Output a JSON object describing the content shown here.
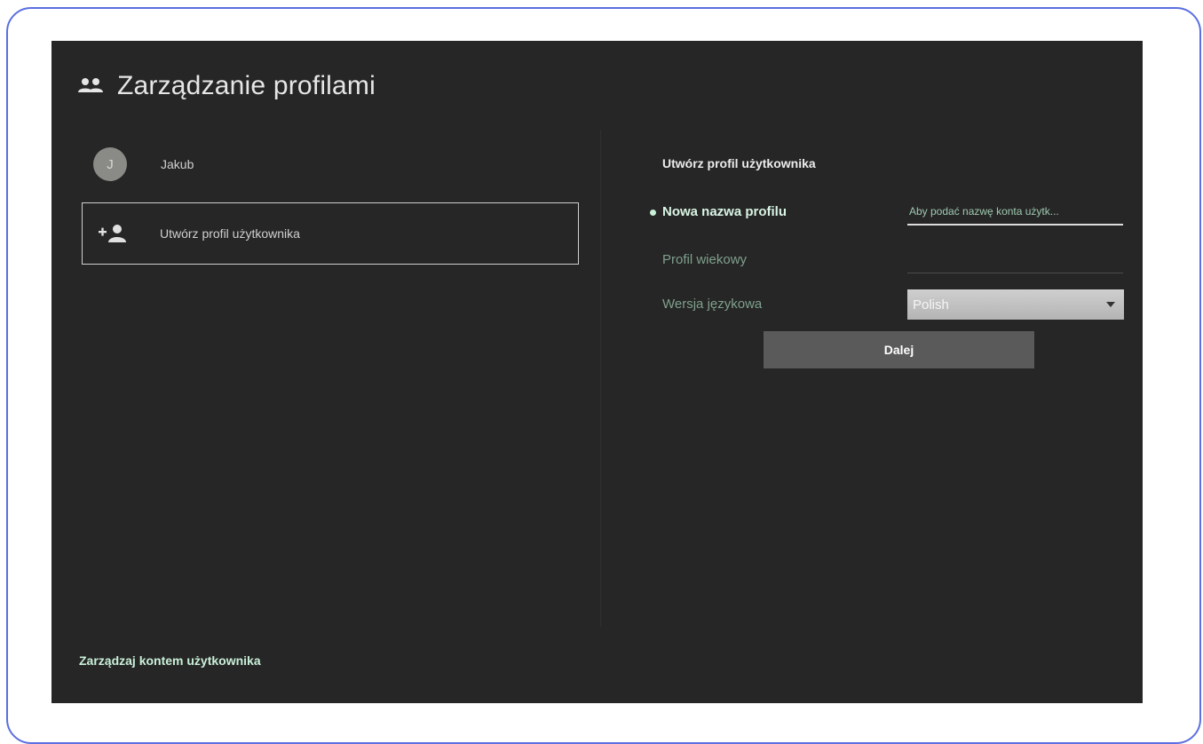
{
  "header": {
    "title": "Zarządzanie profilami",
    "icon": "people-icon"
  },
  "profiles": [
    {
      "initial": "J",
      "name": "Jakub"
    }
  ],
  "create_profile_button": {
    "label": "Utwórz profil użytkownika",
    "icon": "add-user-icon"
  },
  "form": {
    "title": "Utwórz profil użytkownika",
    "name_label": "Nowa nazwa profilu",
    "name_placeholder": "Aby podać nazwę konta użytk...",
    "age_label": "Profil wiekowy",
    "language_label": "Wersja językowa",
    "language_value": "Polish",
    "next_button": "Dalej"
  },
  "footer": {
    "manage_account": "Zarządzaj kontem użytkownika"
  },
  "colors": {
    "background": "#262626",
    "accent": "#c9f0d9",
    "muted_label": "#7fa08c"
  }
}
